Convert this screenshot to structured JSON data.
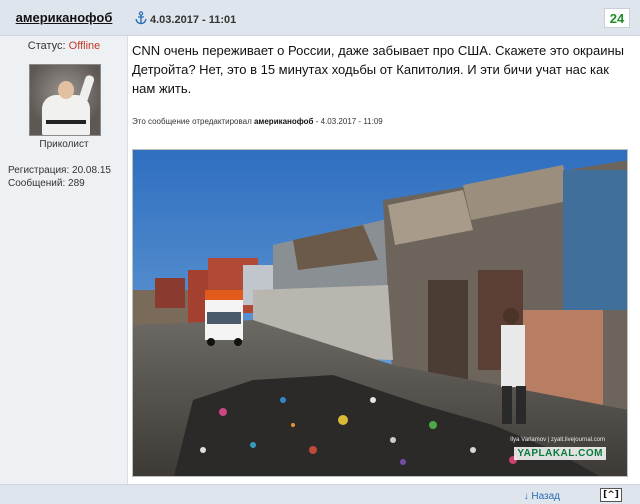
{
  "author": {
    "name": "американофоб",
    "status_label": "Статус:",
    "status_value": "Offline",
    "rank": "Приколист",
    "registration_label": "Регистрация:",
    "registration_value": "20.08.15",
    "messages_label": "Сообщений:",
    "messages_value": "289"
  },
  "post": {
    "date": "4.03.2017 - 11:01",
    "rating": "24",
    "text": "CNN очень переживает о России, даже забывает про США. Скажете это окраины Детройта? Нет, это в 15 минутах ходьбы от Капитолия. И эти бичи учат нас как нам жить.",
    "edited_prefix": "Это сообщение отредактировал",
    "edited_user": "американофоб",
    "edited_suffix": "- 4.03.2017 - 11:09",
    "image_watermark": "YAPLAKAL.COM",
    "image_credit": "Ilya Varlamov | zyalt.livejournal.com"
  },
  "footer": {
    "reply_label": "↓ Назад",
    "top_label": "[^]"
  },
  "colors": {
    "header_bg": "#dfe5ec",
    "sidebar_bg": "#eef1f4",
    "rating_green": "#1f8f2a",
    "offline_red": "#c0392b"
  }
}
